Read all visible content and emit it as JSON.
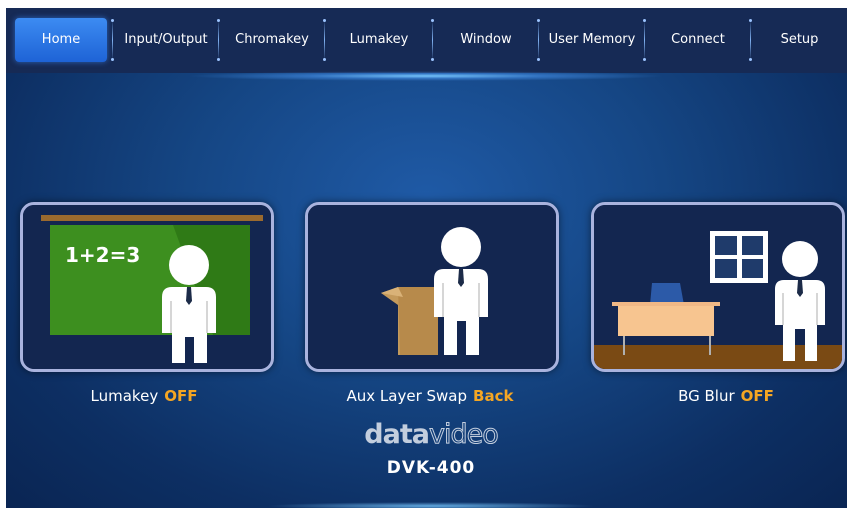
{
  "nav": {
    "items": [
      {
        "label": "Home",
        "active": true
      },
      {
        "label": "Input/Output",
        "active": false
      },
      {
        "label": "Chromakey",
        "active": false
      },
      {
        "label": "Lumakey",
        "active": false
      },
      {
        "label": "Window",
        "active": false
      },
      {
        "label": "User Memory",
        "active": false
      },
      {
        "label": "Connect",
        "active": false
      },
      {
        "label": "Setup",
        "active": false
      }
    ]
  },
  "cards": [
    {
      "name": "Lumakey",
      "state": "OFF",
      "scene_text": "1+2=3",
      "icon": "classroom-teacher-icon"
    },
    {
      "name": "Aux Layer Swap",
      "state": "Back",
      "icon": "podium-speaker-icon"
    },
    {
      "name": "BG Blur",
      "state": "OFF",
      "icon": "office-person-icon"
    }
  ],
  "brand": {
    "part1": "data",
    "part2": "video",
    "model": "DVK-400"
  },
  "colors": {
    "accent": "#f5a623",
    "active_tab": "#2f7be8",
    "background": "#154684",
    "card_border": "#a9b3de"
  }
}
